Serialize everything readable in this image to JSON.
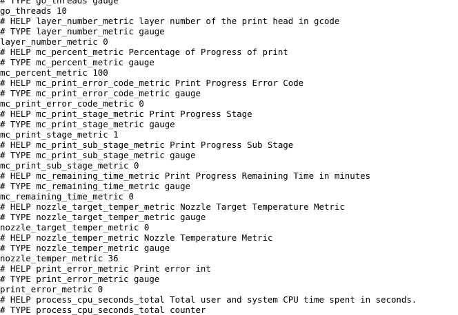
{
  "lines": [
    "# TYPE go_threads gauge",
    "go_threads 10",
    "# HELP layer_number_metric layer number of the print head in gcode",
    "# TYPE layer_number_metric gauge",
    "layer_number_metric 0",
    "# HELP mc_percent_metric Percentage of Progress of print",
    "# TYPE mc_percent_metric gauge",
    "mc_percent_metric 100",
    "# HELP mc_print_error_code_metric Print Progress Error Code",
    "# TYPE mc_print_error_code_metric gauge",
    "mc_print_error_code_metric 0",
    "# HELP mc_print_stage_metric Print Progress Stage",
    "# TYPE mc_print_stage_metric gauge",
    "mc_print_stage_metric 1",
    "# HELP mc_print_sub_stage_metric Print Progress Sub Stage",
    "# TYPE mc_print_sub_stage_metric gauge",
    "mc_print_sub_stage_metric 0",
    "# HELP mc_remaining_time_metric Print Progress Remaining Time in minutes",
    "# TYPE mc_remaining_time_metric gauge",
    "mc_remaining_time_metric 0",
    "# HELP nozzle_target_temper_metric Nozzle Target Temperature Metric",
    "# TYPE nozzle_target_temper_metric gauge",
    "nozzle_target_temper_metric 0",
    "# HELP nozzle_temper_metric Nozzle Temperature Metric",
    "# TYPE nozzle_temper_metric gauge",
    "nozzle_temper_metric 36",
    "# HELP print_error_metric Print error int",
    "# TYPE print_error_metric gauge",
    "print_error_metric 0",
    "# HELP process_cpu_seconds_total Total user and system CPU time spent in seconds.",
    "# TYPE process_cpu_seconds_total counter"
  ]
}
